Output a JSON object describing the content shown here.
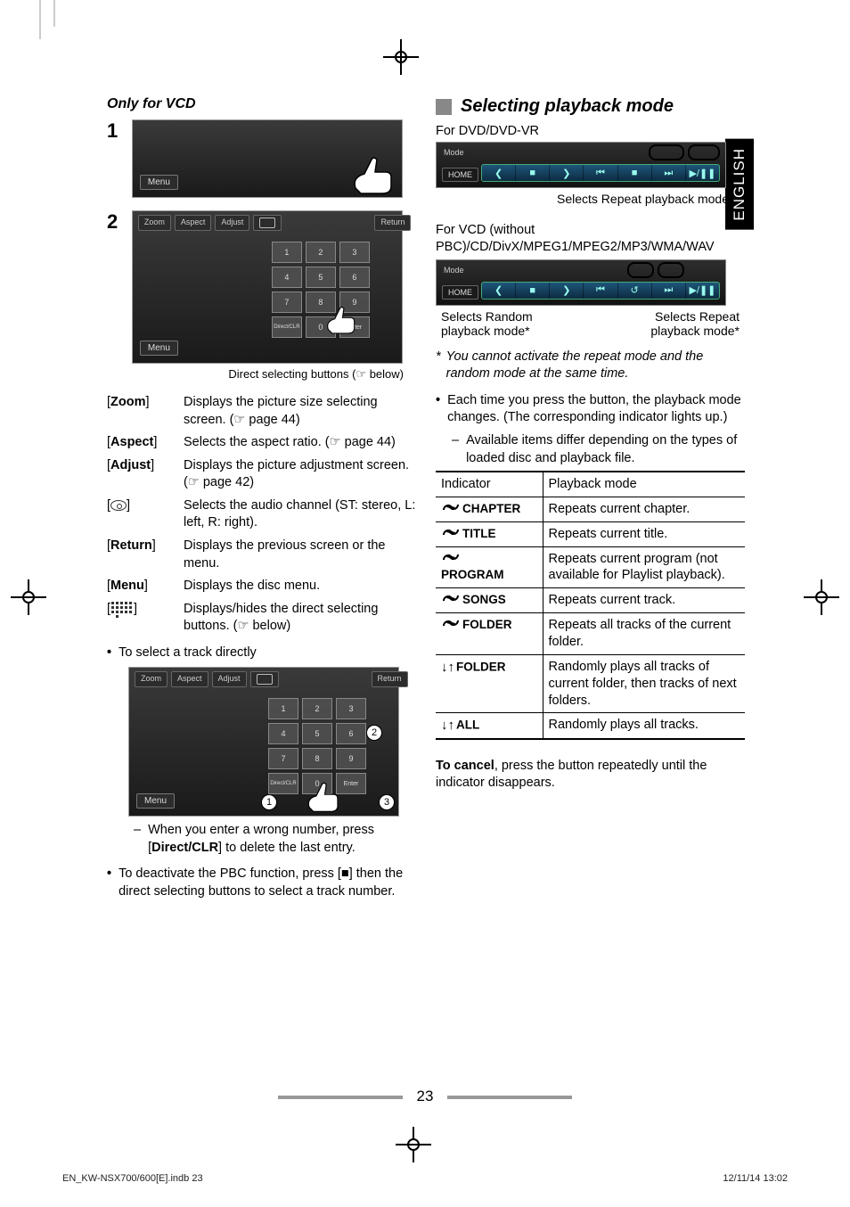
{
  "side_tab": "ENGLISH",
  "left": {
    "title": "Only for VCD",
    "step1": "1",
    "step2": "2",
    "screenshot_common": {
      "menu": "Menu",
      "zoom": "Zoom",
      "aspect": "Aspect",
      "adjust": "Adjust",
      "return": "Return",
      "keys": [
        "1",
        "2",
        "3",
        "4",
        "5",
        "6",
        "7",
        "8",
        "9",
        "Direct/CLR",
        "0",
        "Enter"
      ]
    },
    "caption_direct": "Direct selecting buttons (☞ below)",
    "defs": [
      {
        "label": "[Zoom]",
        "text": "Displays the picture size selecting screen. (☞ page 44)"
      },
      {
        "label": "[Aspect]",
        "text": "Selects the aspect ratio. (☞ page 44)"
      },
      {
        "label": "[Adjust]",
        "text": "Displays the picture adjustment screen. (☞ page 42)"
      },
      {
        "label": "disc",
        "text": "Selects the audio channel (ST: stereo, L: left, R: right)."
      },
      {
        "label": "[Return]",
        "text": "Displays the previous screen or the menu."
      },
      {
        "label": "[Menu]",
        "text": "Displays the disc menu."
      },
      {
        "label": "numpad",
        "text": "Displays/hides the direct selecting buttons. (☞ below)"
      }
    ],
    "bullet_select": "To select a track directly",
    "sub_wrong_a": "When you enter a wrong number, press [",
    "sub_wrong_b": "Direct/CLR",
    "sub_wrong_c": "] to delete the last entry.",
    "bullet_pbc": "To deactivate the PBC function, press [■] then the direct selecting buttons to select a track number."
  },
  "right": {
    "h2": "Selecting playback mode",
    "for_dvd": "For DVD/DVD-VR",
    "dvd_callout": "Selects Repeat playback mode",
    "for_vcd": "For VCD (without PBC)/CD/DivX/MPEG1/MPEG2/MP3/WMA/WAV",
    "remote": {
      "mode": "Mode",
      "home": "HOME",
      "btns": [
        "❮",
        "■",
        "❯",
        "⏮",
        "■",
        "⏭",
        "▶/❚❚"
      ]
    },
    "vcd_callout_l1": "Selects Random",
    "vcd_callout_l2": "playback mode*",
    "vcd_callout_r1": "Selects Repeat",
    "vcd_callout_r2": "playback mode*",
    "footnote": "You cannot activate the repeat mode and the random mode at the same time.",
    "bullet_each": "Each time you press the button, the playback mode changes. (The corresponding indicator lights up.)",
    "sub_avail": "Available items differ depending on the types of loaded disc and playback file.",
    "table": {
      "head_a": "Indicator",
      "head_b": "Playback mode",
      "rows": [
        {
          "icon": "repeat",
          "label": "CHAPTER",
          "desc": "Repeats current chapter."
        },
        {
          "icon": "repeat",
          "label": "TITLE",
          "desc": "Repeats current title."
        },
        {
          "icon": "repeat",
          "label": "PROGRAM",
          "desc": "Repeats current program (not available for Playlist playback)."
        },
        {
          "icon": "repeat",
          "label": "SONGS",
          "desc": "Repeats current track."
        },
        {
          "icon": "repeat",
          "label": "FOLDER",
          "desc": "Repeats all tracks of the current folder."
        },
        {
          "icon": "shuffle",
          "label": "FOLDER",
          "desc": "Randomly plays all tracks of current folder, then tracks of next folders."
        },
        {
          "icon": "shuffle",
          "label": "ALL",
          "desc": "Randomly plays all tracks."
        }
      ]
    },
    "cancel_a": "To cancel",
    "cancel_b": ", press the button repeatedly until the indicator disappears."
  },
  "page_number": "23",
  "footer_left": "EN_KW-NSX700/600[E].indb   23",
  "footer_right": "12/11/14   13:02"
}
